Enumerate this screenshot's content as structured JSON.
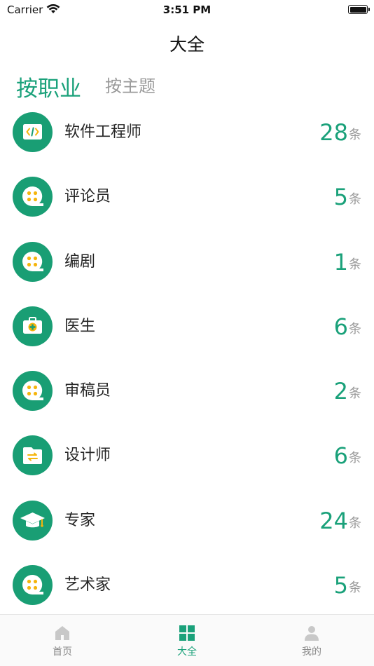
{
  "status_bar": {
    "carrier": "Carrier",
    "time": "3:51 PM"
  },
  "nav": {
    "title": "大全"
  },
  "tabs": [
    {
      "label": "按职业",
      "active": true
    },
    {
      "label": "按主题",
      "active": false
    }
  ],
  "list": [
    {
      "label": "软件工程师",
      "count": "28",
      "unit": "条",
      "icon": "code-doc-icon"
    },
    {
      "label": "评论员",
      "count": "5",
      "unit": "条",
      "icon": "film-reel-icon"
    },
    {
      "label": "编剧",
      "count": "1",
      "unit": "条",
      "icon": "film-reel-icon"
    },
    {
      "label": "医生",
      "count": "6",
      "unit": "条",
      "icon": "medical-kit-icon"
    },
    {
      "label": "审稿员",
      "count": "2",
      "unit": "条",
      "icon": "film-reel-icon"
    },
    {
      "label": "设计师",
      "count": "6",
      "unit": "条",
      "icon": "folder-exchange-icon"
    },
    {
      "label": "专家",
      "count": "24",
      "unit": "条",
      "icon": "graduation-cap-icon"
    },
    {
      "label": "艺术家",
      "count": "5",
      "unit": "条",
      "icon": "film-reel-icon"
    }
  ],
  "tab_bar": [
    {
      "label": "首页",
      "icon": "home-icon",
      "active": false
    },
    {
      "label": "大全",
      "icon": "grid-icon",
      "active": true
    },
    {
      "label": "我的",
      "icon": "person-icon",
      "active": false
    }
  ],
  "colors": {
    "accent": "#1aa17a",
    "icon_bg": "#199e74",
    "icon_yellow": "#f5c518",
    "inactive": "#9a9a9a"
  }
}
